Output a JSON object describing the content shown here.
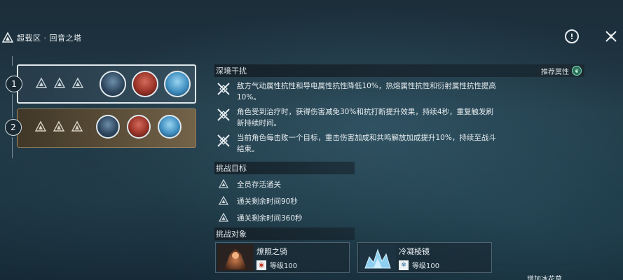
{
  "header": {
    "title": "超载区 · 回音之塔"
  },
  "info_icon": "!",
  "stages": [
    {
      "number": "1",
      "stars": 3,
      "selected": true
    },
    {
      "number": "2",
      "stars": 3,
      "selected": false
    }
  ],
  "disturbance": {
    "title": "深境干扰",
    "recommend_label": "推荐属性",
    "items": [
      "敌方气动属性抗性和导电属性抗性降低10%，热熔属性抗性和衍射属性抗性提高10%。",
      "角色受到治疗时，获得伤害减免30%和抗打断提升效果，持续4秒，重复触发刷新持续时间。",
      "当前角色每击败一个目标，重击伤害加成和共鸣解放加成提升10%，持续至战斗结束。"
    ]
  },
  "goals": {
    "title": "挑战目标",
    "items": [
      "全员存活通关",
      "通关剩余时间90秒",
      "通关剩余时间360秒"
    ]
  },
  "targets": {
    "title": "挑战对象",
    "items": [
      {
        "name": "燎照之骑",
        "level": "等级100",
        "element_icon": "fusion-icon"
      },
      {
        "name": "冷凝棱镜",
        "level": "等级100",
        "element_icon": "glacio-icon"
      }
    ]
  },
  "bottom_hint": "增加冰花草"
}
